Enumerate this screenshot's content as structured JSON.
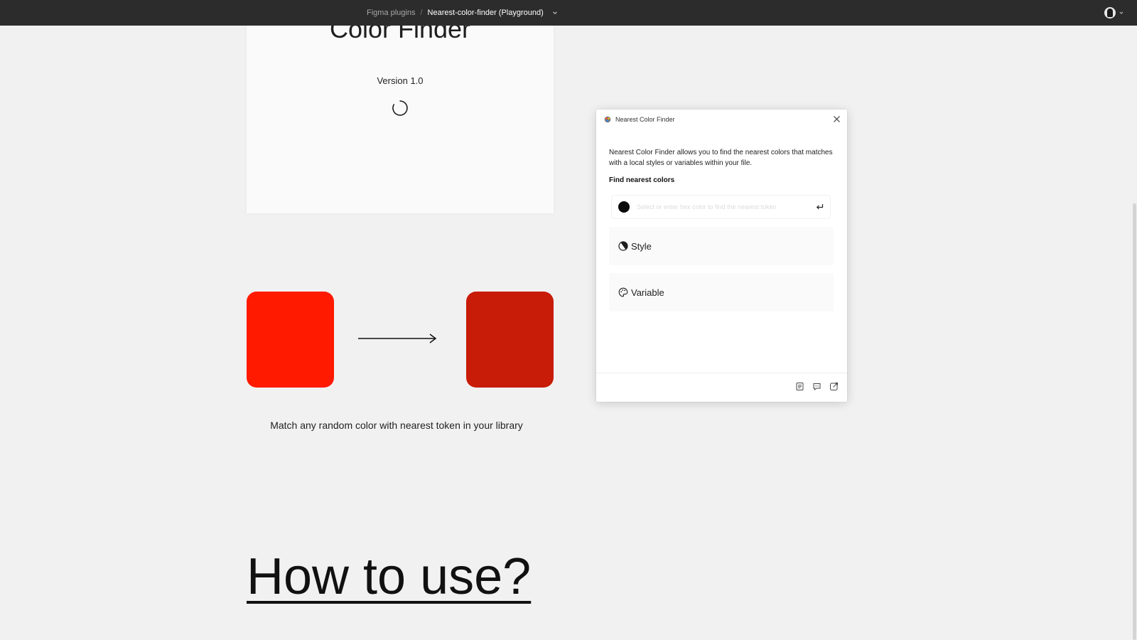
{
  "topbar": {
    "breadcrumb_parent": "Figma plugins",
    "breadcrumb_separator": "/",
    "breadcrumb_current": "Nearest-color-finder (Playground)",
    "dropdown_icon": "chevron-down-icon",
    "avatar_icon": "avatar"
  },
  "canvas": {
    "cover_title": "Color Finder",
    "cover_version": "Version 1.0",
    "loading_icon": "spinner-icon",
    "source_color": "#ff1a00",
    "target_color": "#c81b08",
    "tagline": "Match any random color with nearest token in your library",
    "howto_heading": "How to use?"
  },
  "plugin": {
    "title": "Nearest Color Finder",
    "description": "Nearest Color Finder allows you to find the nearest colors that matches with a local styles or variables within your file.",
    "section_title": "Find nearest colors",
    "input_placeholder": "Select or enter hex color to find the nearest token",
    "input_value": "",
    "selected_color": "#0b0b0b",
    "options": [
      {
        "label": "Style",
        "icon": "style-icon"
      },
      {
        "label": "Variable",
        "icon": "palette-icon"
      }
    ],
    "footer_icons": [
      "document-icon",
      "comment-icon",
      "share-icon"
    ]
  },
  "colors": {
    "topbar_bg": "#2c2c2c",
    "canvas_bg": "#f1f1f1",
    "plugin_bg": "#ffffff"
  }
}
